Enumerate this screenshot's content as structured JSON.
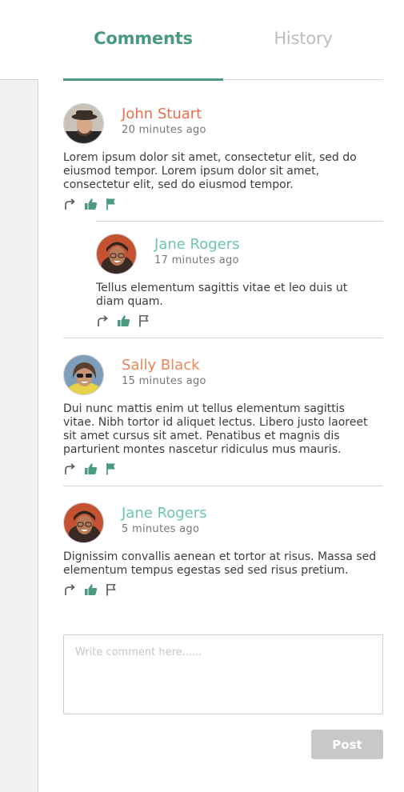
{
  "tabs": {
    "comments_label": "Comments",
    "history_label": "History"
  },
  "comments": [
    {
      "author": "John Stuart",
      "author_color": "#e8704f",
      "time": "20 minutes ago",
      "text": "Lorem ipsum dolor sit amet, consectetur elit, sed do eiusmod tempor. Lorem ipsum dolor sit amet, consectetur elit, sed do eiusmod tempor.",
      "liked": true,
      "flagged": true,
      "replies": [
        {
          "author": "Jane Rogers",
          "author_color": "#6cc7a8",
          "time": "17 minutes ago",
          "text": "Tellus elementum sagittis vitae et leo duis ut diam quam.",
          "liked": true,
          "flagged": false
        }
      ]
    },
    {
      "author": "Sally Black",
      "author_color": "#e8865a",
      "time": "15 minutes ago",
      "text": "Dui nunc mattis enim ut tellus elementum sagittis vitae. Nibh tortor id aliquet lectus. Libero justo laoreet sit amet cursus sit amet. Penatibus et magnis dis parturient montes nascetur ridiculus mus mauris.",
      "liked": true,
      "flagged": true
    },
    {
      "author": "Jane Rogers",
      "author_color": "#6cc7a8",
      "time": "5 minutes ago",
      "text": "Dignissim convallis aenean et tortor at risus. Massa sed elementum tempus egestas sed sed risus pretium.",
      "liked": true,
      "flagged": false
    }
  ],
  "composer": {
    "placeholder": "Write comment here......",
    "value": ""
  },
  "post_button_label": "Post",
  "colors": {
    "accent": "#4a9a7e",
    "inactive_tab": "#bdbdbd",
    "button_disabled": "#c8c8c8"
  },
  "icons": [
    "reply-icon",
    "thumbs-up-icon",
    "flag-icon"
  ]
}
